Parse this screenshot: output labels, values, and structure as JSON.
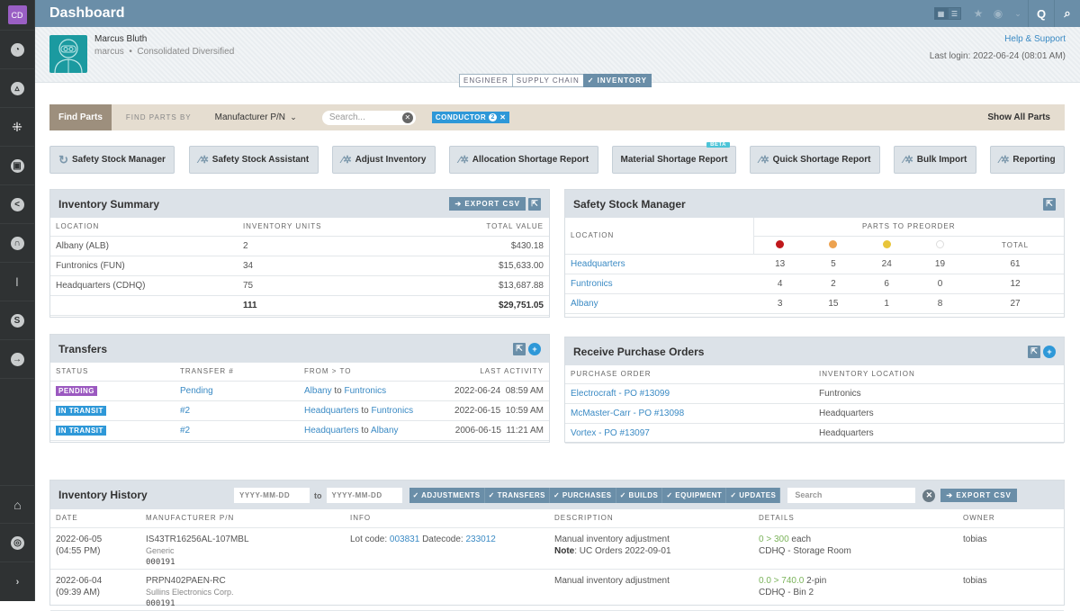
{
  "sidebar": {
    "logo": "CD",
    "items": [
      {
        "icon": "speedometer-icon"
      },
      {
        "icon": "recycle-icon"
      },
      {
        "icon": "grid-dots-icon"
      },
      {
        "icon": "box-icon"
      },
      {
        "icon": "share-icon"
      },
      {
        "icon": "headset-icon"
      },
      {
        "icon": "wrench-icon"
      },
      {
        "icon": "dollar-icon"
      },
      {
        "icon": "arrow-right-circle-icon"
      }
    ],
    "bottom": [
      {
        "icon": "home-icon"
      },
      {
        "icon": "lifebuoy-icon"
      },
      {
        "icon": "chevron-right-icon"
      }
    ]
  },
  "topbar": {
    "title": "Dashboard"
  },
  "user": {
    "name": "Marcus Bluth",
    "username": "marcus",
    "company": "Consolidated Diversified",
    "help_link": "Help & Support",
    "last_login": "Last login: 2022-06-24 (08:01 AM)"
  },
  "roles": [
    {
      "label": "ENGINEER",
      "active": false
    },
    {
      "label": "SUPPLY CHAIN",
      "active": false
    },
    {
      "label": "✓ INVENTORY",
      "active": true
    }
  ],
  "findbar": {
    "button": "Find Parts",
    "by_label": "FIND PARTS BY",
    "selected": "Manufacturer P/N",
    "search_placeholder": "Search...",
    "tag_label": "CONDUCTOR",
    "tag_count": "2",
    "show_all": "Show All Parts"
  },
  "actions": [
    {
      "label": "Safety Stock Manager",
      "icon": "refresh-icon"
    },
    {
      "label": "Safety Stock Assistant",
      "icon": "magic-wand-icon"
    },
    {
      "label": "Adjust Inventory",
      "icon": "magic-wand-icon"
    },
    {
      "label": "Allocation Shortage Report",
      "icon": "magic-wand-icon"
    },
    {
      "label": "Material Shortage Report",
      "icon": "",
      "badge": "BETA"
    },
    {
      "label": "Quick Shortage Report",
      "icon": "magic-wand-icon"
    },
    {
      "label": "Bulk Import",
      "icon": "magic-wand-icon"
    },
    {
      "label": "Reporting",
      "icon": "magic-wand-icon"
    }
  ],
  "inventory_summary": {
    "title": "Inventory Summary",
    "export": "EXPORT CSV",
    "headers": [
      "LOCATION",
      "INVENTORY UNITS",
      "TOTAL VALUE"
    ],
    "rows": [
      [
        "Albany (ALB)",
        "2",
        "$430.18"
      ],
      [
        "Funtronics (FUN)",
        "34",
        "$15,633.00"
      ],
      [
        "Headquarters (CDHQ)",
        "75",
        "$13,687.88"
      ]
    ],
    "total_units": "111",
    "total_value": "$29,751.05"
  },
  "safety_stock": {
    "title": "Safety Stock Manager",
    "location_header": "LOCATION",
    "group_header": "PARTS TO PREORDER",
    "total_header": "TOTAL",
    "dot_colors": [
      "#c0181b",
      "#eda24f",
      "#e8c53a",
      "#ffffff"
    ],
    "rows": [
      {
        "location": "Headquarters",
        "values": [
          "13",
          "5",
          "24",
          "19"
        ],
        "total": "61"
      },
      {
        "location": "Funtronics",
        "values": [
          "4",
          "2",
          "6",
          "0"
        ],
        "total": "12"
      },
      {
        "location": "Albany",
        "values": [
          "3",
          "15",
          "1",
          "8"
        ],
        "total": "27"
      }
    ]
  },
  "transfers": {
    "title": "Transfers",
    "headers": [
      "STATUS",
      "TRANSFER #",
      "FROM > TO",
      "LAST ACTIVITY"
    ],
    "rows": [
      {
        "status": "PENDING",
        "status_color": "#9b59c0",
        "transfer": "Pending",
        "from": "Albany",
        "to": "Funtronics",
        "date": "2022-06-24",
        "time": "08:59 AM"
      },
      {
        "status": "IN TRANSIT",
        "status_color": "#2e98d8",
        "transfer": "#2",
        "from": "Headquarters",
        "to": "Funtronics",
        "date": "2022-06-15",
        "time": "10:59 AM"
      },
      {
        "status": "IN TRANSIT",
        "status_color": "#2e98d8",
        "transfer": "#2",
        "from": "Headquarters",
        "to": "Albany",
        "date": "2006-06-15",
        "time": "11:21 AM"
      }
    ],
    "to_word": "to"
  },
  "purchase_orders": {
    "title": "Receive Purchase Orders",
    "headers": [
      "PURCHASE ORDER",
      "INVENTORY LOCATION"
    ],
    "rows": [
      [
        "Electrocraft - PO #13099",
        "Funtronics"
      ],
      [
        "McMaster-Carr - PO #13098",
        "Headquarters"
      ],
      [
        "Vortex - PO #13097",
        "Headquarters"
      ]
    ]
  },
  "history": {
    "title": "Inventory History",
    "date_placeholder": "YYYY-MM-DD",
    "to_word": "to",
    "filters": [
      "✓ ADJUSTMENTS",
      "✓ TRANSFERS",
      "✓ PURCHASES",
      "✓ BUILDS",
      "✓ EQUIPMENT",
      "✓ UPDATES"
    ],
    "search_placeholder": "Search",
    "export": "EXPORT CSV",
    "headers": [
      "DATE",
      "MANUFACTURER P/N",
      "INFO",
      "DESCRIPTION",
      "DETAILS",
      "OWNER"
    ],
    "rows": [
      {
        "date": "2022-06-05",
        "time": "(04:55 PM)",
        "mpn": "IS43TR16256AL-107MBL",
        "mfr": "Generic",
        "ipn": "000191",
        "info_lot_label": "Lot code: ",
        "info_lot": "003831",
        "info_dc_label": " Datecode: ",
        "info_dc": "233012",
        "desc": "Manual inventory adjustment",
        "note_label": "Note",
        "note": ": UC Orders 2022-09-01",
        "change": "0 > 300",
        "unit": " each",
        "loc": "CDHQ - Storage Room",
        "owner": "tobias"
      },
      {
        "date": "2022-06-04",
        "time": "(09:39 AM)",
        "mpn": "PRPN402PAEN-RC",
        "mfr": "Sullins Electronics Corp.",
        "ipn": "000191",
        "info_lot_label": "",
        "info_lot": "",
        "info_dc_label": "",
        "info_dc": "",
        "desc": "Manual inventory adjustment",
        "note_label": "",
        "note": "",
        "change": "0.0 > 740.0",
        "unit": " 2-pin",
        "loc": "CDHQ - Bin 2",
        "owner": "tobias"
      }
    ]
  }
}
